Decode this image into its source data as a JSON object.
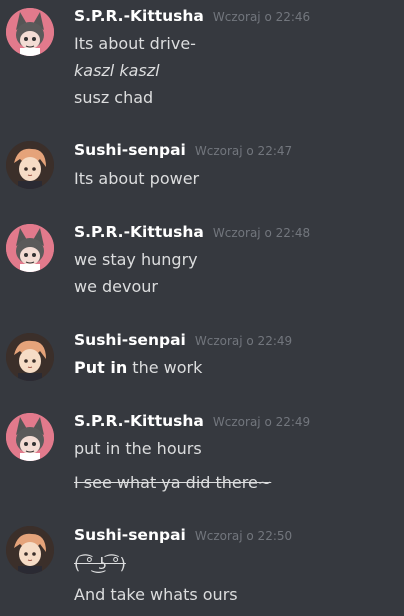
{
  "messages": [
    {
      "author": "S.P.R.-Kittusha",
      "time": "Wczoraj o 22:46",
      "lines": [
        "Its about drive-",
        "kaszl kaszl",
        "susz chad"
      ]
    },
    {
      "author": "Sushi-senpai",
      "time": "Wczoraj o 22:47",
      "lines": [
        "Its about power"
      ]
    },
    {
      "author": "S.P.R.-Kittusha",
      "time": "Wczoraj o 22:48",
      "lines": [
        "we stay hungry",
        "we devour"
      ]
    },
    {
      "author": "Sushi-senpai",
      "time": "Wczoraj o 22:49",
      "bold_part": "Put in",
      "rest": " the work"
    },
    {
      "author": "S.P.R.-Kittusha",
      "time": "Wczoraj o 22:49",
      "lines": [
        "put in the hours",
        "I see what ya did there~"
      ]
    },
    {
      "author": "Sushi-senpai",
      "time": "Wczoraj o 22:50",
      "lines": [
        "( ͡° ͜ʖ ͡°)",
        "And take whats ours"
      ]
    }
  ],
  "colors": {
    "background": "#36393f",
    "username": "#ffffff",
    "timestamp": "#72767d",
    "text": "#dcddde",
    "kittusha_avatar_bg": "#e27a8c",
    "sushi_avatar_bg": "#3b2f2a"
  }
}
